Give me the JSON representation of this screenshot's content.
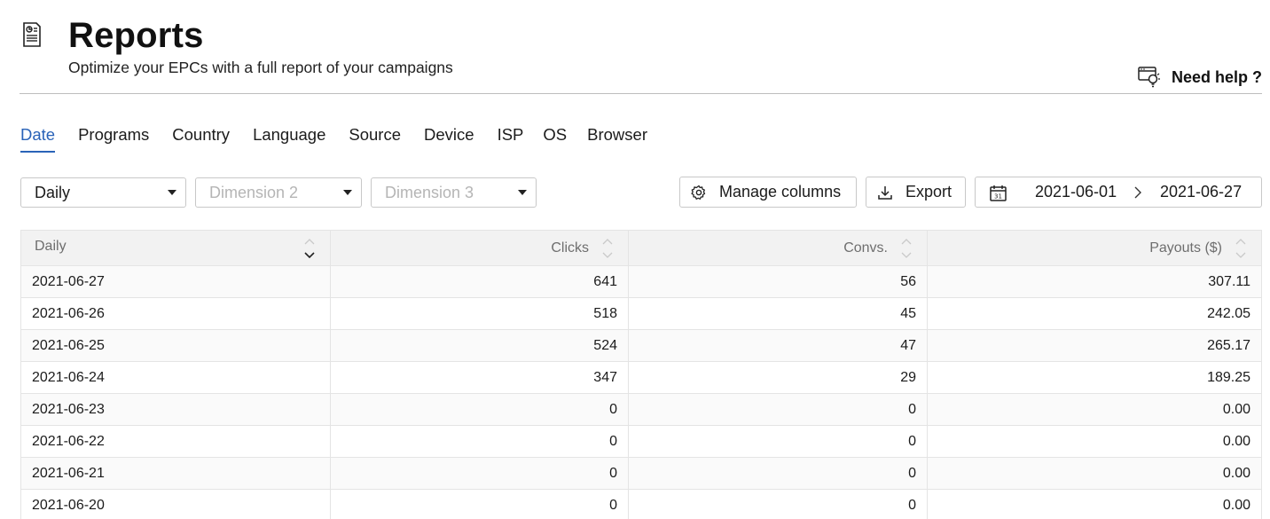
{
  "header": {
    "title": "Reports",
    "subtitle": "Optimize your EPCs with a full report of your campaigns",
    "help_label": "Need help ?"
  },
  "tabs": [
    {
      "label": "Date",
      "active": true
    },
    {
      "label": "Programs"
    },
    {
      "label": "Country"
    },
    {
      "label": "Language"
    },
    {
      "label": "Source"
    },
    {
      "label": "Device"
    },
    {
      "label": "ISP"
    },
    {
      "label": "OS"
    },
    {
      "label": "Browser"
    }
  ],
  "filters": {
    "dimension1": "Daily",
    "dimension2_placeholder": "Dimension 2",
    "dimension3_placeholder": "Dimension 3"
  },
  "toolbar": {
    "manage_columns": "Manage columns",
    "export": "Export",
    "date_from": "2021-06-01",
    "date_to": "2021-06-27"
  },
  "table": {
    "columns": [
      "Daily",
      "Clicks",
      "Convs.",
      "Payouts ($)"
    ],
    "rows": [
      {
        "date": "2021-06-27",
        "clicks": "641",
        "convs": "56",
        "payouts": "307.11"
      },
      {
        "date": "2021-06-26",
        "clicks": "518",
        "convs": "45",
        "payouts": "242.05"
      },
      {
        "date": "2021-06-25",
        "clicks": "524",
        "convs": "47",
        "payouts": "265.17"
      },
      {
        "date": "2021-06-24",
        "clicks": "347",
        "convs": "29",
        "payouts": "189.25"
      },
      {
        "date": "2021-06-23",
        "clicks": "0",
        "convs": "0",
        "payouts": "0.00"
      },
      {
        "date": "2021-06-22",
        "clicks": "0",
        "convs": "0",
        "payouts": "0.00"
      },
      {
        "date": "2021-06-21",
        "clicks": "0",
        "convs": "0",
        "payouts": "0.00"
      },
      {
        "date": "2021-06-20",
        "clicks": "0",
        "convs": "0",
        "payouts": "0.00"
      }
    ]
  },
  "colors": {
    "accent": "#2a63b8",
    "text": "#1b1b1b",
    "header_bg": "#f2f2f2"
  },
  "icons": {
    "page": "report-document-icon",
    "help": "help-lightbulb-icon",
    "settings": "gear-icon",
    "export": "download-icon",
    "calendar": "calendar-icon"
  }
}
